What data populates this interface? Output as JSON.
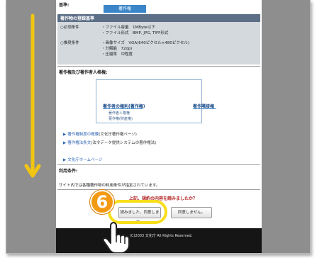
{
  "header": {
    "partial_title": "基準:"
  },
  "requirements": {
    "title": "著作物の登録基準",
    "required_label": "○必須条件",
    "required_items": [
      "・ファイル容量　1MByte以下",
      "・ファイル形式　BMP, JPG, TIFF形式"
    ],
    "recommended_label": "○推奨条件",
    "recommended_items": [
      "・画像サイズ　VGA(640ピクセル×480ピクセル)",
      "・分解能　72dpi",
      "・圧縮率　中程度"
    ]
  },
  "rights": {
    "title": "著作権及び著作者人格権:",
    "diagram_head": "著作権",
    "left_group": "著作者の権利(著作権)",
    "left_items": [
      "著作者人格権",
      "著作権(財産権)"
    ],
    "right_group": "著作隣接権"
  },
  "links": [
    {
      "text": "著作権制度の概要",
      "suffix": "(文化庁著作権ページ)"
    },
    {
      "text": "著作権法条文",
      "suffix": "(法令データ提供システムの著作権法)"
    },
    {
      "text": "文化庁ホームページ",
      "suffix": ""
    }
  ],
  "usage": {
    "title": "利用条件:",
    "text": "サイト内では各種著作物の利用条件が指定されています。"
  },
  "prompt": {
    "question": "上記、規約の内容を読みましたか？",
    "agree_label": "読みました、同意します。",
    "disagree_label": "同意しません。"
  },
  "footer": {
    "copyright": "(C)2003 文化庁 All Rights Reserved."
  },
  "annotation": {
    "step_number": "6"
  },
  "colors": {
    "accent_yellow": "#f7de1a",
    "badge_orange": "#f39a12",
    "question_red": "#b01b1b",
    "section_bar": "#5c6f86"
  }
}
